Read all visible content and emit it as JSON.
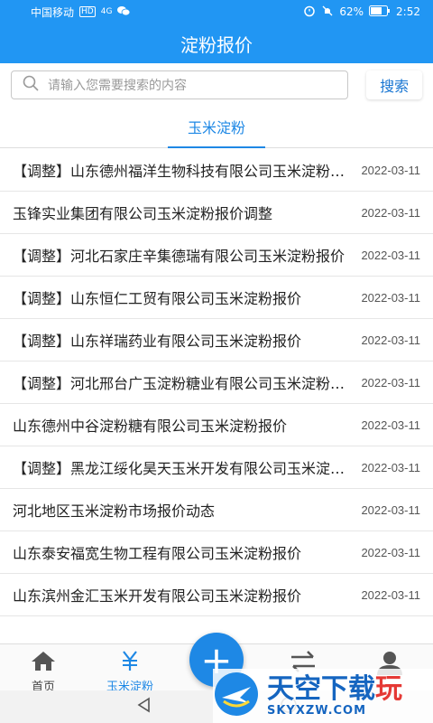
{
  "status_bar": {
    "carrier": "中国移动",
    "hd": "HD",
    "signal": "4G",
    "battery": "62%",
    "time": "2:52"
  },
  "header": {
    "title": "淀粉报价"
  },
  "search": {
    "placeholder": "请输入您需要搜索的内容",
    "button_label": "搜索"
  },
  "tabs": [
    {
      "label": "玉米淀粉"
    }
  ],
  "list": [
    {
      "title": "【调整】山东德州福洋生物科技有限公司玉米淀粉报价",
      "date": "2022-03-11"
    },
    {
      "title": "玉锋实业集团有限公司玉米淀粉报价调整",
      "date": "2022-03-11"
    },
    {
      "title": "【调整】河北石家庄辛集德瑞有限公司玉米淀粉报价",
      "date": "2022-03-11"
    },
    {
      "title": "【调整】山东恒仁工贸有限公司玉米淀粉报价",
      "date": "2022-03-11"
    },
    {
      "title": "【调整】山东祥瑞药业有限公司玉米淀粉报价",
      "date": "2022-03-11"
    },
    {
      "title": "【调整】河北邢台广玉淀粉糖业有限公司玉米淀粉报价",
      "date": "2022-03-11"
    },
    {
      "title": "山东德州中谷淀粉糖有限公司玉米淀粉报价",
      "date": "2022-03-11"
    },
    {
      "title": "【调整】黑龙江绥化昊天玉米开发有限公司玉米淀粉报价",
      "date": "2022-03-11"
    },
    {
      "title": "河北地区玉米淀粉市场报价动态",
      "date": "2022-03-11"
    },
    {
      "title": "山东泰安福宽生物工程有限公司玉米淀粉报价",
      "date": "2022-03-11"
    },
    {
      "title": "山东滨州金汇玉米开发有限公司玉米淀粉报价",
      "date": "2022-03-11"
    }
  ],
  "bottom_nav": {
    "home_label": "首页",
    "corn_starch_label": "玉米淀粉",
    "plus_label": "+"
  },
  "watermark": {
    "text_main": "天空下载",
    "text_accent": "玩",
    "text_url": "SKYXZW.COM"
  },
  "colors": {
    "primary": "#2196f3",
    "accent_text": "#1e88e5"
  }
}
